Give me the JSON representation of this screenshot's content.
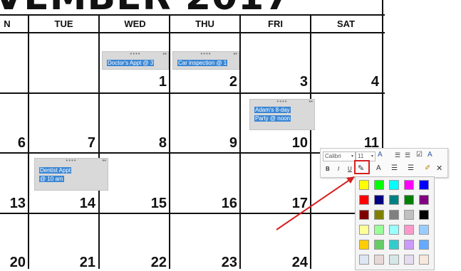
{
  "calendar": {
    "title": "VEMBER 2017",
    "days": [
      "N",
      "TUE",
      "WED",
      "THU",
      "FRI",
      "SAT"
    ],
    "weeks": [
      [
        "",
        "",
        "1",
        "2",
        "3",
        "4"
      ],
      [
        "6",
        "7",
        "8",
        "9",
        "10",
        "11"
      ],
      [
        "13",
        "14",
        "15",
        "16",
        "17",
        ""
      ],
      [
        "20",
        "21",
        "22",
        "23",
        "24",
        ""
      ]
    ]
  },
  "appointments": [
    {
      "lines": [
        "Doctor's Appt @ 3"
      ]
    },
    {
      "lines": [
        "Car inspection @ 1"
      ]
    },
    {
      "lines": [
        "Adam's 8-day",
        "Party @ noon"
      ]
    },
    {
      "lines": [
        "Dentist Appt",
        "@ 10 am"
      ]
    }
  ],
  "toolbar": {
    "font_name": "Calibri",
    "font_size": "11",
    "bold_label": "B",
    "italic_label": "I",
    "underline_label": "U"
  },
  "palette": {
    "rows": [
      [
        "#ffff00",
        "#00ff00",
        "#00ffff",
        "#ff00ff",
        "#0000ff"
      ],
      [
        "#ff0000",
        "#000080",
        "#008080",
        "#008000",
        "#800080"
      ],
      [
        "#800000",
        "#808000",
        "#808080",
        "#c0c0c0",
        "#000000"
      ],
      [
        "#ffff99",
        "#99ff99",
        "#99ffff",
        "#ff99cc",
        "#99ccff"
      ],
      [
        "#ffcc00",
        "#66cc66",
        "#33cccc",
        "#cc99ff",
        "#66aaff"
      ],
      [
        "#dde6f2",
        "#e7d7d7",
        "#d7e7e7",
        "#e6dcef",
        "#f7e8dc"
      ]
    ]
  }
}
